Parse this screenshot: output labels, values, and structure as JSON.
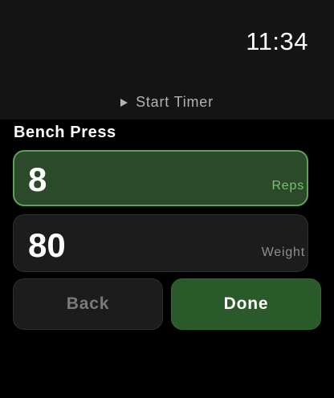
{
  "status": {
    "time": "11:34"
  },
  "timer": {
    "label": "Start Timer",
    "icon": "play-icon"
  },
  "exercise": {
    "title": "Bench Press"
  },
  "fields": {
    "reps": {
      "value": "8",
      "label": "Reps"
    },
    "weight": {
      "value": "80",
      "label": "Weight"
    }
  },
  "actions": {
    "back_label": "Back",
    "done_label": "Done"
  },
  "colors": {
    "accent_green": "#5fa05a",
    "reps_fill": "#2b4a2a",
    "done_fill": "#2b5a2a",
    "reps_label": "#7bc077"
  }
}
